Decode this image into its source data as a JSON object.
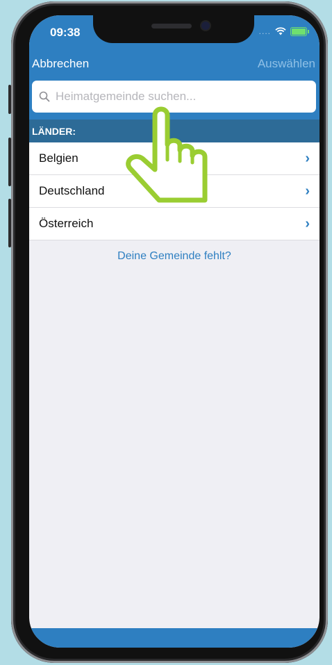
{
  "status_bar": {
    "time": "09:38"
  },
  "nav": {
    "cancel_label": "Abbrechen",
    "select_label": "Auswählen"
  },
  "search": {
    "placeholder": "Heimatgemeinde suchen...",
    "value": ""
  },
  "section": {
    "header": "LÄNDER:"
  },
  "countries": [
    {
      "label": "Belgien"
    },
    {
      "label": "Deutschland"
    },
    {
      "label": "Österreich"
    }
  ],
  "footer_link": "Deine Gemeinde fehlt?",
  "colors": {
    "primary": "#2e7fc1",
    "section": "#2d6b97",
    "hand": "#9acd32",
    "background": "#b3dde6"
  },
  "icons": {
    "search": "magnifier-icon",
    "chevron": "chevron-right-icon",
    "hand": "pointing-hand-icon"
  }
}
